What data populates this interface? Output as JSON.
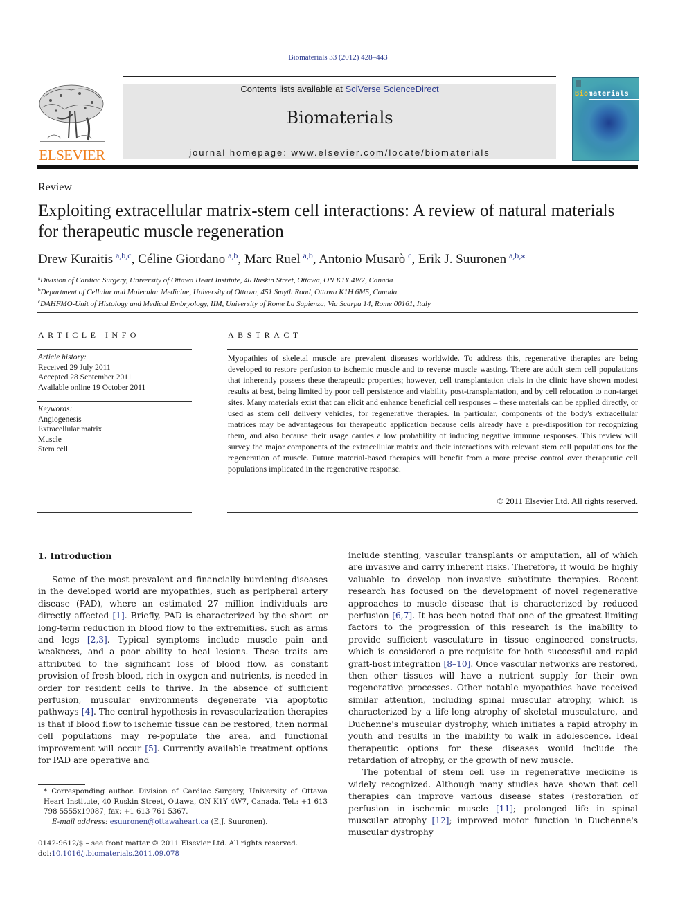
{
  "header": {
    "citation": "Biomaterials 33 (2012) 428–443",
    "contents_prefix": "Contents lists available at ",
    "contents_link": "SciVerse ScienceDirect",
    "journal_name": "Biomaterials",
    "homepage": "journal homepage: www.elsevier.com/locate/biomaterials",
    "publisher_wordmark": "ELSEVIER",
    "cover": {
      "title_highlight": "Bio",
      "title_rest": "materials"
    },
    "colors": {
      "link": "#2b3a8f",
      "publisher_orange": "#f07f1b",
      "masthead_bg": "#e6e6e6"
    }
  },
  "article": {
    "type": "Review",
    "title": "Exploiting extracellular matrix-stem cell interactions: A review of natural materials for therapeutic muscle regeneration",
    "authors": [
      {
        "name": "Drew Kuraitis",
        "sup": "a,b,c"
      },
      {
        "name": "Céline Giordano",
        "sup": "a,b"
      },
      {
        "name": "Marc Ruel",
        "sup": "a,b"
      },
      {
        "name": "Antonio Musarò",
        "sup": "c"
      },
      {
        "name": "Erik J. Suuronen",
        "sup": "a,b,⁎"
      }
    ],
    "affiliations": [
      {
        "key": "a",
        "text": "Division of Cardiac Surgery, University of Ottawa Heart Institute, 40 Ruskin Street, Ottawa, ON K1Y 4W7, Canada"
      },
      {
        "key": "b",
        "text": "Department of Cellular and Molecular Medicine, University of Ottawa, 451 Smyth Road, Ottawa K1H 6M5, Canada"
      },
      {
        "key": "c",
        "text": "DAHFMO-Unit of Histology and Medical Embryology, IIM, University of Rome La Sapienza, Via Scarpa 14, Rome 00161, Italy"
      }
    ]
  },
  "article_info": {
    "heading": "ARTICLE INFO",
    "history_label": "Article history:",
    "history": [
      "Received 29 July 2011",
      "Accepted 28 September 2011",
      "Available online 19 October 2011"
    ],
    "keywords_label": "Keywords:",
    "keywords": [
      "Angiogenesis",
      "Extracellular matrix",
      "Muscle",
      "Stem cell"
    ]
  },
  "abstract": {
    "heading": "ABSTRACT",
    "text": "Myopathies of skeletal muscle are prevalent diseases worldwide. To address this, regenerative therapies are being developed to restore perfusion to ischemic muscle and to reverse muscle wasting. There are adult stem cell populations that inherently possess these therapeutic properties; however, cell transplantation trials in the clinic have shown modest results at best, being limited by poor cell persistence and viability post-transplantation, and by cell relocation to non-target sites. Many materials exist that can elicit and enhance beneficial cell responses – these materials can be applied directly, or used as stem cell delivery vehicles, for regenerative therapies. In particular, components of the body's extracellular matrices may be advantageous for therapeutic application because cells already have a pre-disposition for recognizing them, and also because their usage carries a low probability of inducing negative immune responses. This review will survey the major components of the extracellular matrix and their interactions with relevant stem cell populations for the regeneration of muscle. Future material-based therapies will benefit from a more precise control over therapeutic cell populations implicated in the regenerative response.",
    "copyright": "© 2011 Elsevier Ltd. All rights reserved."
  },
  "body": {
    "section_heading": "1.  Introduction",
    "left": {
      "p1": [
        "Some of the most prevalent and financially burdening diseases in the developed world are myopathies, such as peripheral artery disease (PAD), where an estimated 27 million individuals are directly affected ",
        "[1]",
        ". Briefly, PAD is characterized by the short- or long-term reduction in blood flow to the extremities, such as arms and legs ",
        "[2,3]",
        ". Typical symptoms include muscle pain and weakness, and a poor ability to heal lesions. These traits are attributed to the significant loss of blood flow, as constant provision of fresh blood, rich in oxygen and nutrients, is needed in order for resident cells to thrive. In the absence of sufficient perfusion, muscular environments degenerate via apoptotic pathways ",
        "[4]",
        ". The central hypothesis in revascularization therapies is that if blood flow to ischemic tissue can be restored, then normal cell populations may re-populate the area, and functional improvement will occur ",
        "[5]",
        ". Currently available treatment options for PAD are operative and"
      ]
    },
    "right": {
      "p1": [
        "include stenting, vascular transplants or amputation, all of which are invasive and carry inherent risks. Therefore, it would be highly valuable to develop non-invasive substitute therapies. Recent research has focused on the development of novel regenerative approaches to muscle disease that is characterized by reduced perfusion ",
        "[6,7]",
        ". It has been noted that one of the greatest limiting factors to the progression of this research is the inability to provide sufficient vasculature in tissue engineered constructs, which is considered a pre-requisite for both successful and rapid graft-host integration ",
        "[8–10]",
        ". Once vascular networks are restored, then other tissues will have a nutrient supply for their own regenerative processes. Other notable myopathies have received similar attention, including spinal muscular atrophy, which is characterized by a life-long atrophy of skeletal musculature, and Duchenne's muscular dystrophy, which initiates a rapid atrophy in youth and results in the inability to walk in adolescence. Ideal therapeutic options for these diseases would include the retardation of atrophy, or the growth of new muscle."
      ],
      "p2": [
        "The potential of stem cell use in regenerative medicine is widely recognized. Although many studies have shown that cell therapies can improve various disease states (restoration of perfusion in ischemic muscle ",
        "[11]",
        "; prolonged life in spinal muscular atrophy ",
        "[12]",
        "; improved motor function in Duchenne's muscular dystrophy"
      ]
    }
  },
  "footnotes": {
    "corresponding": "* Corresponding author. Division of Cardiac Surgery, University of Ottawa Heart Institute, 40 Ruskin Street, Ottawa, ON K1Y 4W7, Canada. Tel.: +1 613 798 5555x19087; fax: +1 613 761 5367.",
    "email_label": "E-mail address: ",
    "email": "esuuronen@ottawaheart.ca",
    "email_suffix": " (E.J. Suuronen).",
    "front_matter": "0142-9612/$ – see front matter © 2011 Elsevier Ltd. All rights reserved.",
    "doi_prefix": "doi:",
    "doi": "10.1016/j.biomaterials.2011.09.078"
  }
}
